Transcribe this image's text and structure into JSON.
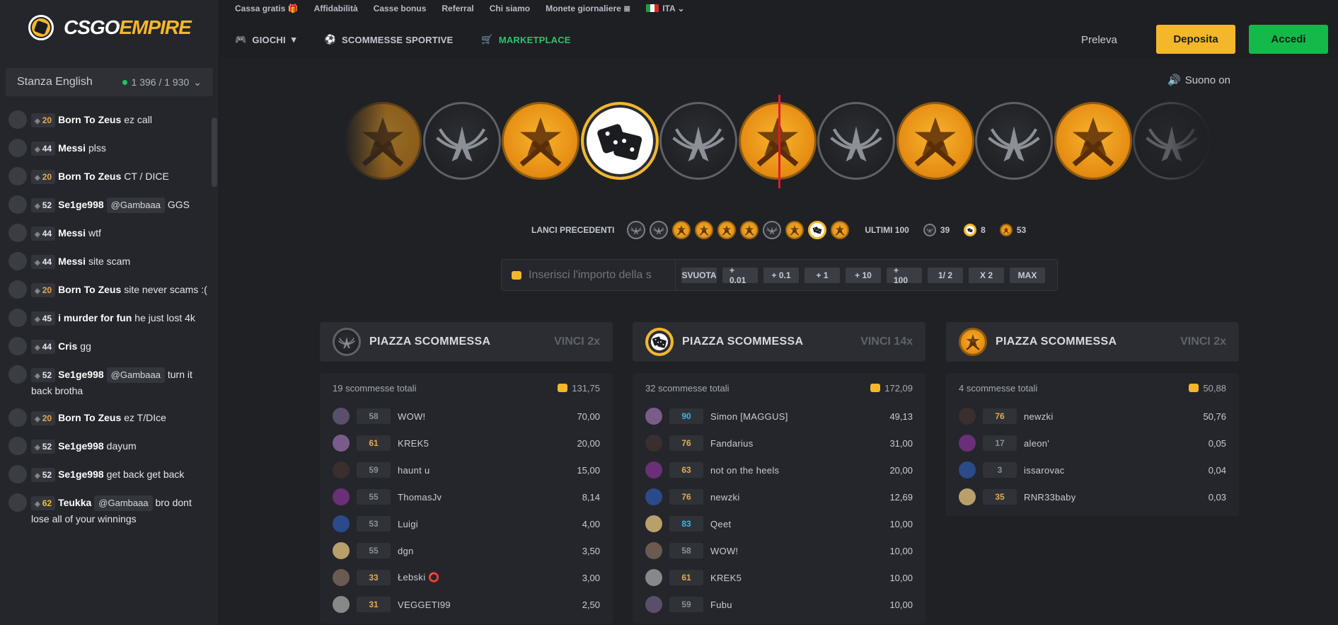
{
  "logo": {
    "text_a": "CSGO",
    "text_b": "EMPIRE"
  },
  "top_links": [
    "Cassa gratis",
    "Affidabilità",
    "Casse bonus",
    "Referral",
    "Chi siamo",
    "Monete giornaliere"
  ],
  "language": "ITA",
  "nav": {
    "games": "GIOCHI",
    "sports": "SCOMMESSE SPORTIVE",
    "market": "MARKETPLACE"
  },
  "account": {
    "withdraw": "Preleva",
    "deposit": "Deposita",
    "login": "Accedi"
  },
  "chat_room": {
    "name": "Stanza English",
    "online": "1 396 / 1 930"
  },
  "chat": [
    {
      "level": "20",
      "cls": "o",
      "user": "Born To Zeus",
      "text": "ez call"
    },
    {
      "level": "44",
      "cls": "w",
      "user": "Messi",
      "text": "plss"
    },
    {
      "level": "20",
      "cls": "o",
      "user": "Born To Zeus",
      "text": "CT / DICE"
    },
    {
      "level": "52",
      "cls": "w",
      "user": "Se1ge998",
      "mention": "@Gambaaa",
      "text": "GGS"
    },
    {
      "level": "44",
      "cls": "w",
      "user": "Messi",
      "text": "wtf"
    },
    {
      "level": "44",
      "cls": "w",
      "user": "Messi",
      "text": "site scam"
    },
    {
      "level": "20",
      "cls": "o",
      "user": "Born To Zeus",
      "text": "site never scams :("
    },
    {
      "level": "45",
      "cls": "w",
      "user": "i murder for fun",
      "text": "he just lost 4k"
    },
    {
      "level": "44",
      "cls": "w",
      "user": "Cris",
      "text": "gg"
    },
    {
      "level": "52",
      "cls": "w",
      "user": "Se1ge998",
      "mention": "@Gambaaa",
      "text": "turn it back brotha"
    },
    {
      "level": "20",
      "cls": "o",
      "user": "Born To Zeus",
      "text": "ez T/DIce"
    },
    {
      "level": "52",
      "cls": "w",
      "user": "Se1ge998",
      "text": "dayum"
    },
    {
      "level": "52",
      "cls": "w",
      "user": "Se1ge998",
      "text": "get back get back"
    },
    {
      "level": "62",
      "cls": "y",
      "user": "Teukka",
      "mention": "@Gambaaa",
      "text": "bro dont lose all of your winnings"
    }
  ],
  "sound": "Suono on",
  "strip": [
    "t",
    "ct",
    "t",
    "dice",
    "ct",
    "t",
    "ct",
    "t",
    "ct",
    "t",
    "ct"
  ],
  "history": {
    "label": "LANCI PRECEDENTI",
    "coins": [
      "ct",
      "ct",
      "t",
      "t",
      "t",
      "t",
      "ct",
      "t",
      "dice",
      "t"
    ],
    "last100_label": "ULTIMI 100",
    "ct_count": "39",
    "dice_count": "8",
    "t_count": "53"
  },
  "bet": {
    "placeholder": "Inserisci l'importo della s",
    "buttons": [
      "SVUOTA",
      "+ 0.01",
      "+ 0.1",
      "+ 1",
      "+ 10",
      "+ 100",
      "1/ 2",
      "X 2",
      "MAX"
    ]
  },
  "columns": [
    {
      "kind": "ct",
      "title": "PIAZZA SCOMMESSA",
      "win": "VINCI 2x",
      "total": "19 scommesse totali",
      "amount": "131,75",
      "rows": [
        {
          "lvl": "58",
          "c": "g",
          "name": "WOW!",
          "val": "70,00"
        },
        {
          "lvl": "61",
          "c": "o",
          "name": "KREK5",
          "val": "20,00"
        },
        {
          "lvl": "59",
          "c": "g",
          "name": "haunt u",
          "val": "15,00"
        },
        {
          "lvl": "55",
          "c": "g",
          "name": "ThomasJv",
          "val": "8,14"
        },
        {
          "lvl": "53",
          "c": "g",
          "name": "Luigi",
          "val": "4,00"
        },
        {
          "lvl": "55",
          "c": "g",
          "name": "dgn",
          "val": "3,50"
        },
        {
          "lvl": "33",
          "c": "o",
          "name": "Łebski ⭕",
          "val": "3,00"
        },
        {
          "lvl": "31",
          "c": "o",
          "name": "VEGGETI99",
          "val": "2,50"
        }
      ]
    },
    {
      "kind": "dice",
      "title": "PIAZZA SCOMMESSA",
      "win": "VINCI 14x",
      "total": "32 scommesse totali",
      "amount": "172,09",
      "rows": [
        {
          "lvl": "90",
          "c": "b",
          "name": "Simon [MAGGUS]",
          "val": "49,13"
        },
        {
          "lvl": "76",
          "c": "o",
          "name": "Fandarius",
          "val": "31,00"
        },
        {
          "lvl": "63",
          "c": "o",
          "name": "not on the heels",
          "val": "20,00"
        },
        {
          "lvl": "76",
          "c": "o",
          "name": "newzki",
          "val": "12,69"
        },
        {
          "lvl": "83",
          "c": "b",
          "name": "Qeet",
          "val": "10,00"
        },
        {
          "lvl": "58",
          "c": "g",
          "name": "WOW!",
          "val": "10,00"
        },
        {
          "lvl": "61",
          "c": "o",
          "name": "KREK5",
          "val": "10,00"
        },
        {
          "lvl": "59",
          "c": "g",
          "name": "Fubu",
          "val": "10,00"
        }
      ]
    },
    {
      "kind": "t",
      "title": "PIAZZA SCOMMESSA",
      "win": "VINCI 2x",
      "total": "4 scommesse totali",
      "amount": "50,88",
      "rows": [
        {
          "lvl": "76",
          "c": "o",
          "name": "newzki",
          "val": "50,76"
        },
        {
          "lvl": "17",
          "c": "g",
          "name": "aleon'",
          "val": "0,05"
        },
        {
          "lvl": "3",
          "c": "g",
          "name": "issarovac",
          "val": "0,04"
        },
        {
          "lvl": "35",
          "c": "o",
          "name": "RNR33baby",
          "val": "0,03"
        }
      ]
    }
  ]
}
